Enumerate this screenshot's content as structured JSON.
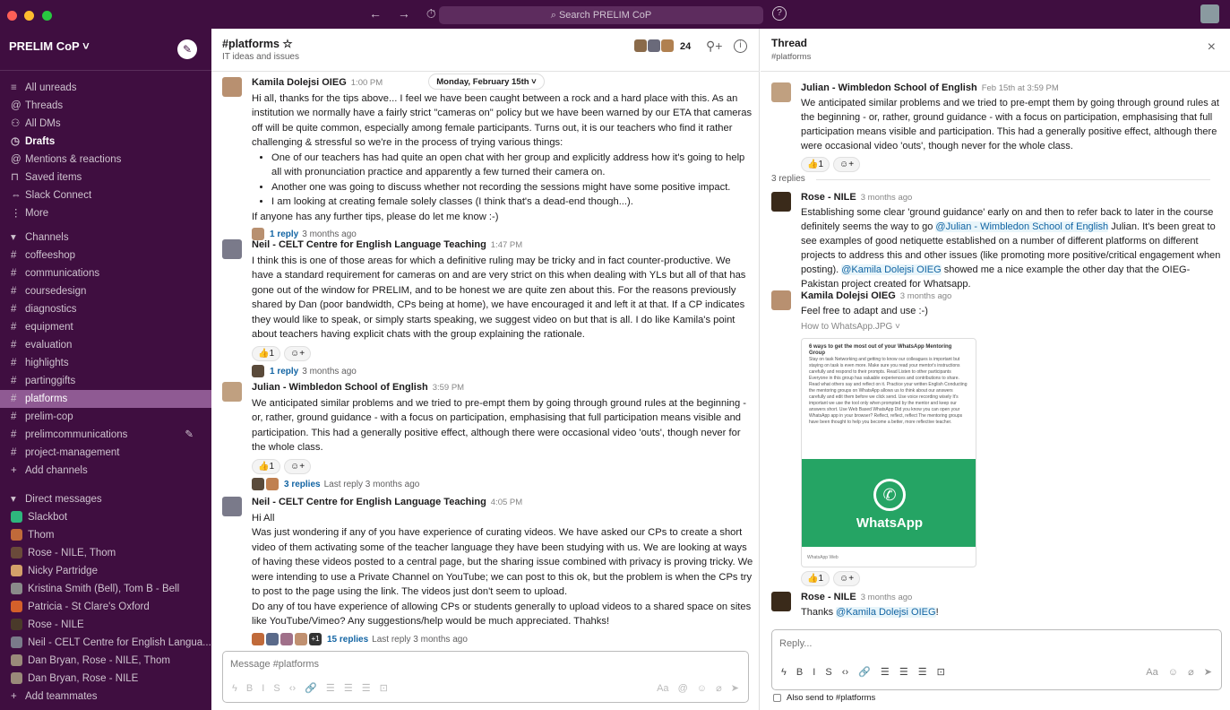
{
  "topbar": {
    "search_placeholder": "Search PRELIM CoP",
    "back": "←",
    "forward": "→",
    "history": "⏱",
    "help": "?"
  },
  "workspace": {
    "name": "PRELIM CoP ˅"
  },
  "nav": [
    {
      "icon": "≡",
      "label": "All unreads"
    },
    {
      "icon": "@",
      "label": "Threads"
    },
    {
      "icon": "⚇",
      "label": "All DMs"
    },
    {
      "icon": "◷",
      "label": "Drafts"
    },
    {
      "icon": "@",
      "label": "Mentions & reactions"
    },
    {
      "icon": "⊓",
      "label": "Saved items"
    },
    {
      "icon": "⇔",
      "label": "Slack Connect"
    },
    {
      "icon": "⋮",
      "label": "More"
    }
  ],
  "channels_header": "Channels",
  "channels": [
    "coffeeshop",
    "communications",
    "coursedesign",
    "diagnostics",
    "equipment",
    "evaluation",
    "highlights",
    "partinggifts",
    "platforms",
    "prelim-cop",
    "prelimcommunications",
    "project-management"
  ],
  "add_channels": "Add channels",
  "dms_header": "Direct messages",
  "dms": [
    {
      "label": "Slackbot",
      "color": "#2eb67d"
    },
    {
      "label": "Thom",
      "color": "#c06a3a"
    },
    {
      "label": "Rose - NILE, Thom",
      "color": "#6a4a3a"
    },
    {
      "label": "Nicky Partridge",
      "color": "#d4a06a"
    },
    {
      "label": "Kristina Smith (Bell), Tom B - Bell",
      "color": "#8a8a8a"
    },
    {
      "label": "Patricia - St Clare's Oxford",
      "color": "#d4602a"
    },
    {
      "label": "Rose - NILE",
      "color": "#4a3a2a"
    },
    {
      "label": "Neil - CELT Centre for English Langua...",
      "color": "#7a7a8a"
    },
    {
      "label": "Dan Bryan, Rose - NILE, Thom",
      "color": "#9a8a7a"
    },
    {
      "label": "Dan Bryan, Rose - NILE",
      "color": "#9a8a7a"
    }
  ],
  "add_teammates": "Add teammates",
  "channel": {
    "name": "#platforms ☆",
    "topic": "IT ideas and issues",
    "member_count": "24"
  },
  "date_divider": "Monday, February 15th ˅",
  "messages": {
    "m1": {
      "author": "Kamila Dolejsi OIEG",
      "time": "1:00 PM",
      "p1": "Hi all, thanks for the tips above... I feel we have been caught between a rock and a hard place with this. As an institution we normally have a fairly strict \"cameras on\" policy but we have been warned by our ETA that cameras off will be quite common, especially among female participants. Turns out, it is our teachers who find it rather challenging & stressful so we're in the process of trying various things:",
      "b1": "One of our teachers has had quite an open chat with her group and explicitly address how it's going to help all with pronunciation practice and apparently a few turned their camera on.",
      "b2": "Another one was going to discuss whether not recording the sessions might have some positive impact.",
      "b3": "I am looking at creating female solely classes (I think that's a dead-end though...).",
      "p2": "If anyone has any further tips, please do let me know :-)",
      "reply_link": "1 reply",
      "reply_time": "3 months ago"
    },
    "m2": {
      "author": "Neil - CELT Centre for English Language Teaching",
      "time": "1:47 PM",
      "text": "I think this is one of those areas for which a definitive ruling may be tricky and in fact counter-productive. We have a standard requirement for cameras on and are very strict on this when dealing with YLs but all of that has gone out of the window for PRELIM, and to be honest we are quite zen about this. For the reasons previously shared by Dan (poor bandwidth, CPs being at home), we have encouraged it and left it at that. If a CP indicates they would like to speak, or simply starts speaking, we suggest video on but that is all. I do like Kamila's point about teachers having explicit chats with the group explaining the rationale.",
      "reaction": "👍1",
      "reply_link": "1 reply",
      "reply_time": "3 months ago"
    },
    "m3": {
      "author": "Julian - Wimbledon School of English",
      "time": "3:59 PM",
      "text": "We anticipated similar problems and we tried to pre-empt them by going through ground rules at the beginning - or, rather, ground guidance - with a focus on participation, emphasising that full participation means visible and participation. This had a generally positive effect, although there were occasional video 'outs', though never for the whole class.",
      "reaction": "👍1",
      "reply_link": "3 replies",
      "reply_time": "Last reply 3 months ago"
    },
    "m4": {
      "author": "Neil - CELT Centre for English Language Teaching",
      "time": "4:05 PM",
      "p1": "Hi All",
      "p2": "Was just wondering if any of you have experience of curating videos. We have asked our CPs to create a short video of them activating some of the teacher language they have been studying with us. We are looking at ways of having these videos posted to a central page, but the sharing issue combined with privacy is proving tricky. We were intending to use a Private Channel on YouTube; we can post to this ok, but the problem is when the CPs try to post to the page using the link. The videos just don't seem to upload.",
      "p3": "Do any of tou have experience of allowing CPs or students generally to upload videos to a shared space on sites like YouTube/Vimeo? Any suggestions/help would be much appreciated. Thahks!",
      "extra": "+1",
      "reply_link": "15 replies",
      "reply_time": "Last reply 3 months ago"
    }
  },
  "composer": {
    "placeholder": "Message #platforms",
    "tools_left": "ϟ B I S ‹› 🔗 ☰ ☰ ☰ ⊡",
    "tools_right": "Aa @ ☺ ⌀ ➤"
  },
  "thread": {
    "title": "Thread",
    "subtitle": "#platforms",
    "close": "×",
    "parent": {
      "author": "Julian - Wimbledon School of English",
      "time": "Feb 15th at 3:59 PM",
      "text": "We anticipated similar problems and we tried to pre-empt them by going through ground rules at the beginning - or, rather, ground guidance - with a focus on participation, emphasising that full participation means visible and participation. This had a generally positive effect, although there were occasional video 'outs', though never for the whole class.",
      "reaction": "👍1"
    },
    "reply_count": "3 replies",
    "r1": {
      "author": "Rose - NILE",
      "time": "3 months ago",
      "t1": "Establishing some clear 'ground guidance' early on and then to refer back to later in the course definitely seems the way to go ",
      "mention1": "@Julian - Wimbledon School of English",
      "t2": " Julian. It's been great to see examples of good netiquette established on a number of different platforms on different projects to address this and other issues (like promoting more positive/critical engagement when posting). ",
      "mention2": "@Kamila Dolejsi OIEG",
      "t3": " showed me a nice example the other day that the OIEG-Pakistan project created for Whatsapp."
    },
    "r2": {
      "author": "Kamila Dolejsi OIEG",
      "time": "3 months ago",
      "text": "Feel free to adapt and use :-)",
      "attachment": "How to WhatsApp.JPG ˅",
      "doc_title": "6 ways to get the most out of your WhatsApp Mentoring Group",
      "doc_body": "Stay on task Networking and getting to know our colleagues is important but staying on task is even more. Make sure you read your mentor's instructions carefully and respond to their prompts. Read Listen to other participants Everyone in this group has valuable experiences and contributions to share. Read what others say and reflect on it. Practice your written English Conducting the mentoring groups on WhatsApp allows us to think about our answers carefully and edit them before we click send. Use voice recording wisely It's important we use the tool only when prompted by the mentor and keep our answers short. Use Web Based WhatsApp Did you know you can open your WhatsApp app in your browser? Reflect, reflect, reflect The mentoring groups have been thought to help you become a better, more reflective teacher.",
      "wa_label": "WhatsApp",
      "reaction": "👍1",
      "wa_foot": "WhatsApp Web"
    },
    "r3": {
      "author": "Rose - NILE",
      "time": "3 months ago",
      "text": "Thanks ",
      "mention": "@Kamila Dolejsi OIEG",
      "end": "!"
    },
    "composer": {
      "placeholder": "Reply...",
      "tools_left": "ϟ B I S ‹› 🔗 ☰ ☰ ☰ ⊡",
      "tools_right": "Aa ☺ ⌀ ➤"
    },
    "also_send": "Also send to #platforms"
  }
}
